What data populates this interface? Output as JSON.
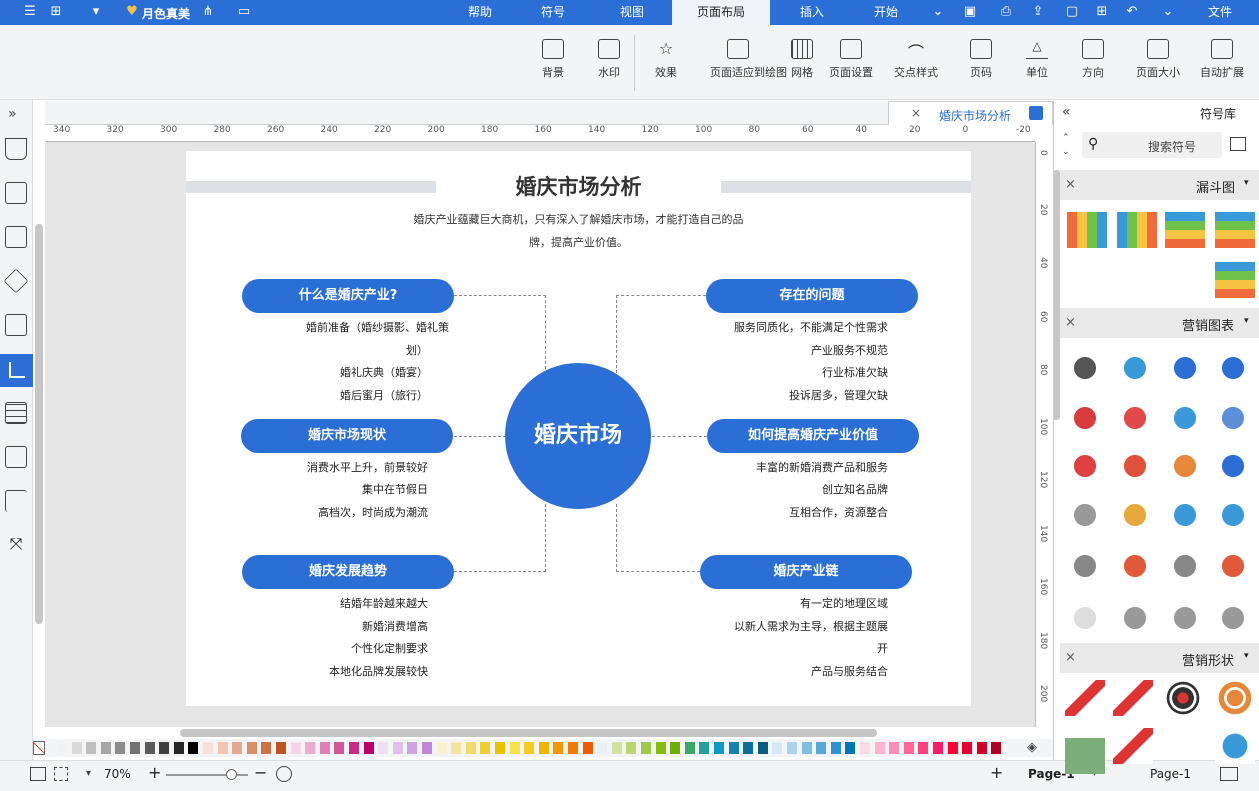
{
  "titlebar": {
    "tabs": [
      "文件",
      "开始",
      "插入",
      "页面布局",
      "视图",
      "符号",
      "帮助"
    ],
    "active_tab": "页面布局",
    "user": "月色真美"
  },
  "ribbon": {
    "buttons": [
      "自动扩展",
      "页面大小",
      "方向",
      "单位",
      "页码",
      "交点样式",
      "页面设置",
      "网格",
      "页面适应到绘图",
      "效果",
      "水印",
      "背景"
    ]
  },
  "doc": {
    "tab_label": "婚庆市场分析"
  },
  "rulers": {
    "h": [
      "340",
      "320",
      "300",
      "280",
      "260",
      "240",
      "220",
      "200",
      "180",
      "160",
      "140",
      "120",
      "100",
      "80",
      "60",
      "40",
      "20",
      "0",
      "-20"
    ],
    "v": [
      "0",
      "20",
      "40",
      "60",
      "80",
      "100",
      "120",
      "140",
      "160",
      "180",
      "200"
    ]
  },
  "diagram": {
    "title": "婚庆市场分析",
    "subtitle1": "婚庆产业蕴藏巨大商机，只有深入了解婚庆市场，才能打造自己的品",
    "subtitle2": "牌，提高产业价值。",
    "center": "婚庆市场",
    "left": [
      {
        "title": "什么是婚庆产业?",
        "items": [
          "婚前准备（婚纱摄影、婚礼策",
          "划）",
          "婚礼庆典（婚宴）",
          "婚后蜜月（旅行）"
        ]
      },
      {
        "title": "婚庆市场现状",
        "items": [
          "消费水平上升，前景较好",
          "集中在节假日",
          "高档次，时尚成为潮流"
        ]
      },
      {
        "title": "婚庆发展趋势",
        "items": [
          "结婚年龄越来越大",
          "新婚消费增高",
          "个性化定制要求",
          "本地化品牌发展较快"
        ]
      }
    ],
    "right": [
      {
        "title": "存在的问题",
        "items": [
          "服务同质化，不能满足个性需求",
          "产业服务不规范",
          "行业标准欠缺",
          "投诉居多，管理欠缺"
        ]
      },
      {
        "title": "如何提高婚庆产业价值",
        "items": [
          "丰富的新婚消费产品和服务",
          "创立知名品牌",
          "互相合作，资源整合"
        ]
      },
      {
        "title": "婚庆产业链",
        "items": [
          "有一定的地理区域",
          "以新人需求为主导，根据主题展",
          "开",
          "产品与服务结合"
        ]
      }
    ]
  },
  "statusbar": {
    "page_label": "Page-1",
    "page_tab": "Page-1",
    "zoom": "70%"
  },
  "library": {
    "title": "符号库",
    "search_placeholder": "搜索符号",
    "sections": [
      "漏斗图",
      "营销图表",
      "营销形状"
    ]
  }
}
